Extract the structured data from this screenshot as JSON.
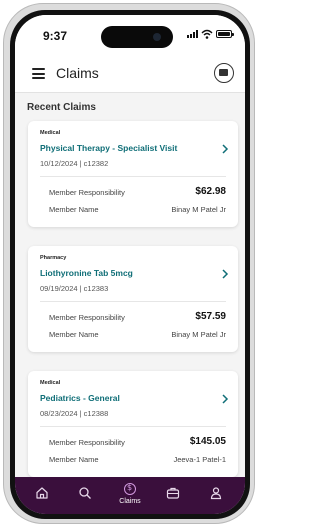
{
  "status_bar": {
    "time": "9:37"
  },
  "header": {
    "title": "Claims"
  },
  "section": {
    "title": "Recent Claims"
  },
  "claims": [
    {
      "category": "Medical",
      "title": "Physical Therapy - Specialist Visit",
      "meta": "10/12/2024 | c12382",
      "responsibility_label": "Member Responsibility",
      "responsibility_value": "$62.98",
      "member_label": "Member Name",
      "member_value": "Binay M Patel Jr"
    },
    {
      "category": "Pharmacy",
      "title": "Liothyronine Tab 5mcg",
      "meta": "09/19/2024 | c12383",
      "responsibility_label": "Member Responsibility",
      "responsibility_value": "$57.59",
      "member_label": "Member Name",
      "member_value": "Binay M Patel Jr"
    },
    {
      "category": "Medical",
      "title": "Pediatrics - General",
      "meta": "08/23/2024 | c12388",
      "responsibility_label": "Member Responsibility",
      "responsibility_value": "$145.05",
      "member_label": "Member Name",
      "member_value": "Jeeva-1 Patel-1"
    }
  ],
  "bottom_nav": {
    "items": [
      {
        "icon": "home-icon",
        "label": ""
      },
      {
        "icon": "search-icon",
        "label": ""
      },
      {
        "icon": "dollar-circle-icon",
        "label": "Claims",
        "active": true
      },
      {
        "icon": "briefcase-icon",
        "label": ""
      },
      {
        "icon": "person-icon",
        "label": ""
      }
    ]
  },
  "colors": {
    "accent_teal": "#0f6e77",
    "nav_background": "#3a0f3c",
    "nav_active": "#d39ae0",
    "screen_background": "#f4f4f4"
  }
}
